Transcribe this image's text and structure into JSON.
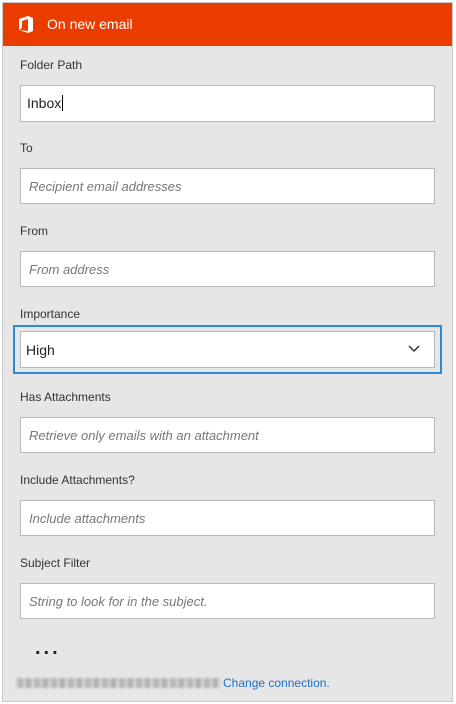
{
  "header": {
    "title": "On new email",
    "icon": "office-icon",
    "color": "#eb3c00"
  },
  "fields": {
    "folder_path": {
      "label": "Folder Path",
      "value": "Inbox"
    },
    "to": {
      "label": "To",
      "placeholder": "Recipient email addresses"
    },
    "from": {
      "label": "From",
      "placeholder": "From address"
    },
    "importance": {
      "label": "Importance",
      "value": "High"
    },
    "has_attachments": {
      "label": "Has Attachments",
      "placeholder": "Retrieve only emails with an attachment"
    },
    "include_attachments": {
      "label": "Include Attachments?",
      "placeholder": "Include attachments"
    },
    "subject_filter": {
      "label": "Subject Filter",
      "placeholder": "String to look for in the subject."
    }
  },
  "more": "...",
  "footer": {
    "change_connection": "Change connection."
  },
  "colors": {
    "focus_border": "#2b88d8",
    "link": "#1b6fc8"
  }
}
